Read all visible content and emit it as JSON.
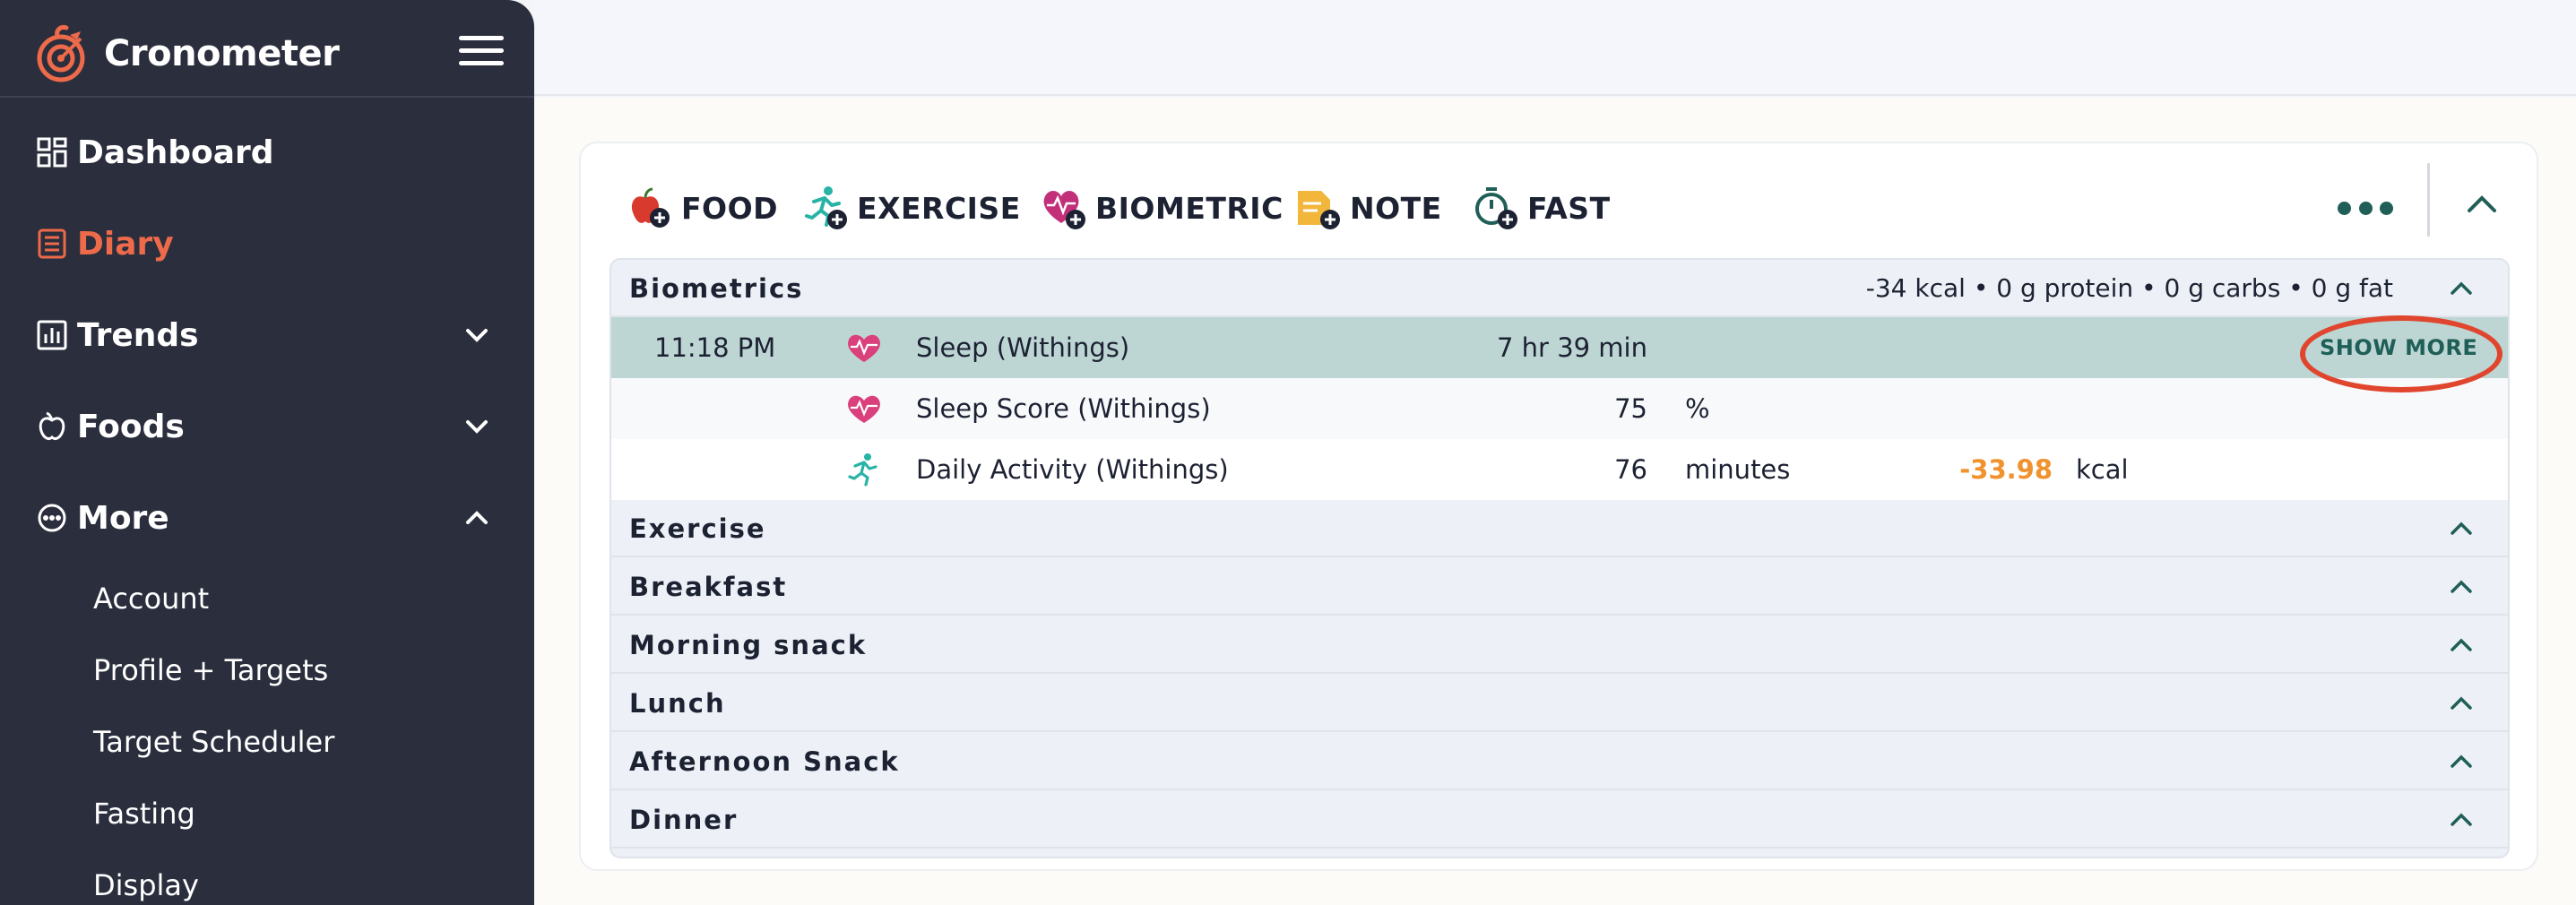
{
  "brand": {
    "name": "Cronometer"
  },
  "sidebar": {
    "items": [
      {
        "label": "Dashboard",
        "icon": "dashboard-grid-icon"
      },
      {
        "label": "Diary",
        "icon": "diary-list-icon",
        "active": true
      },
      {
        "label": "Trends",
        "icon": "bar-chart-icon",
        "expandable": true
      },
      {
        "label": "Foods",
        "icon": "apple-icon",
        "expandable": true
      },
      {
        "label": "More",
        "icon": "dots-circle-icon",
        "expanded": true
      }
    ],
    "more_sub_items": [
      {
        "label": "Account"
      },
      {
        "label": "Profile + Targets"
      },
      {
        "label": "Target Scheduler"
      },
      {
        "label": "Fasting"
      },
      {
        "label": "Display"
      }
    ]
  },
  "toolbar": {
    "food": "FOOD",
    "exercise": "EXERCISE",
    "biometric": "BIOMETRIC",
    "note": "NOTE",
    "fast": "FAST"
  },
  "diary": {
    "biometrics": {
      "title": "Biometrics",
      "summary": "-34 kcal • 0 g protein • 0 g carbs • 0 g fat",
      "rows": [
        {
          "time": "11:18 PM",
          "icon": "heart-pulse-icon",
          "name": "Sleep (Withings)",
          "amount": "7 hr 39 min",
          "unit": "",
          "energy": "",
          "energy_unit": "",
          "action": "SHOW MORE"
        },
        {
          "time": "",
          "icon": "heart-pulse-icon",
          "name": "Sleep Score (Withings)",
          "amount": "75",
          "unit": "%",
          "energy": "",
          "energy_unit": ""
        },
        {
          "time": "",
          "icon": "running-person-icon",
          "name": "Daily Activity (Withings)",
          "amount": "76",
          "unit": "minutes",
          "energy": "-33.98",
          "energy_unit": "kcal"
        }
      ]
    },
    "sections": [
      {
        "title": "Exercise"
      },
      {
        "title": "Breakfast"
      },
      {
        "title": "Morning snack"
      },
      {
        "title": "Lunch"
      },
      {
        "title": "Afternoon Snack"
      },
      {
        "title": "Dinner"
      }
    ]
  },
  "colors": {
    "sidebar_bg": "#2b2e3d",
    "accent": "#ed6a4a",
    "teal": "#1f5f57",
    "highlight_row": "#bdd6d4",
    "energy": "#f0922e",
    "annotation": "#e0452d"
  }
}
